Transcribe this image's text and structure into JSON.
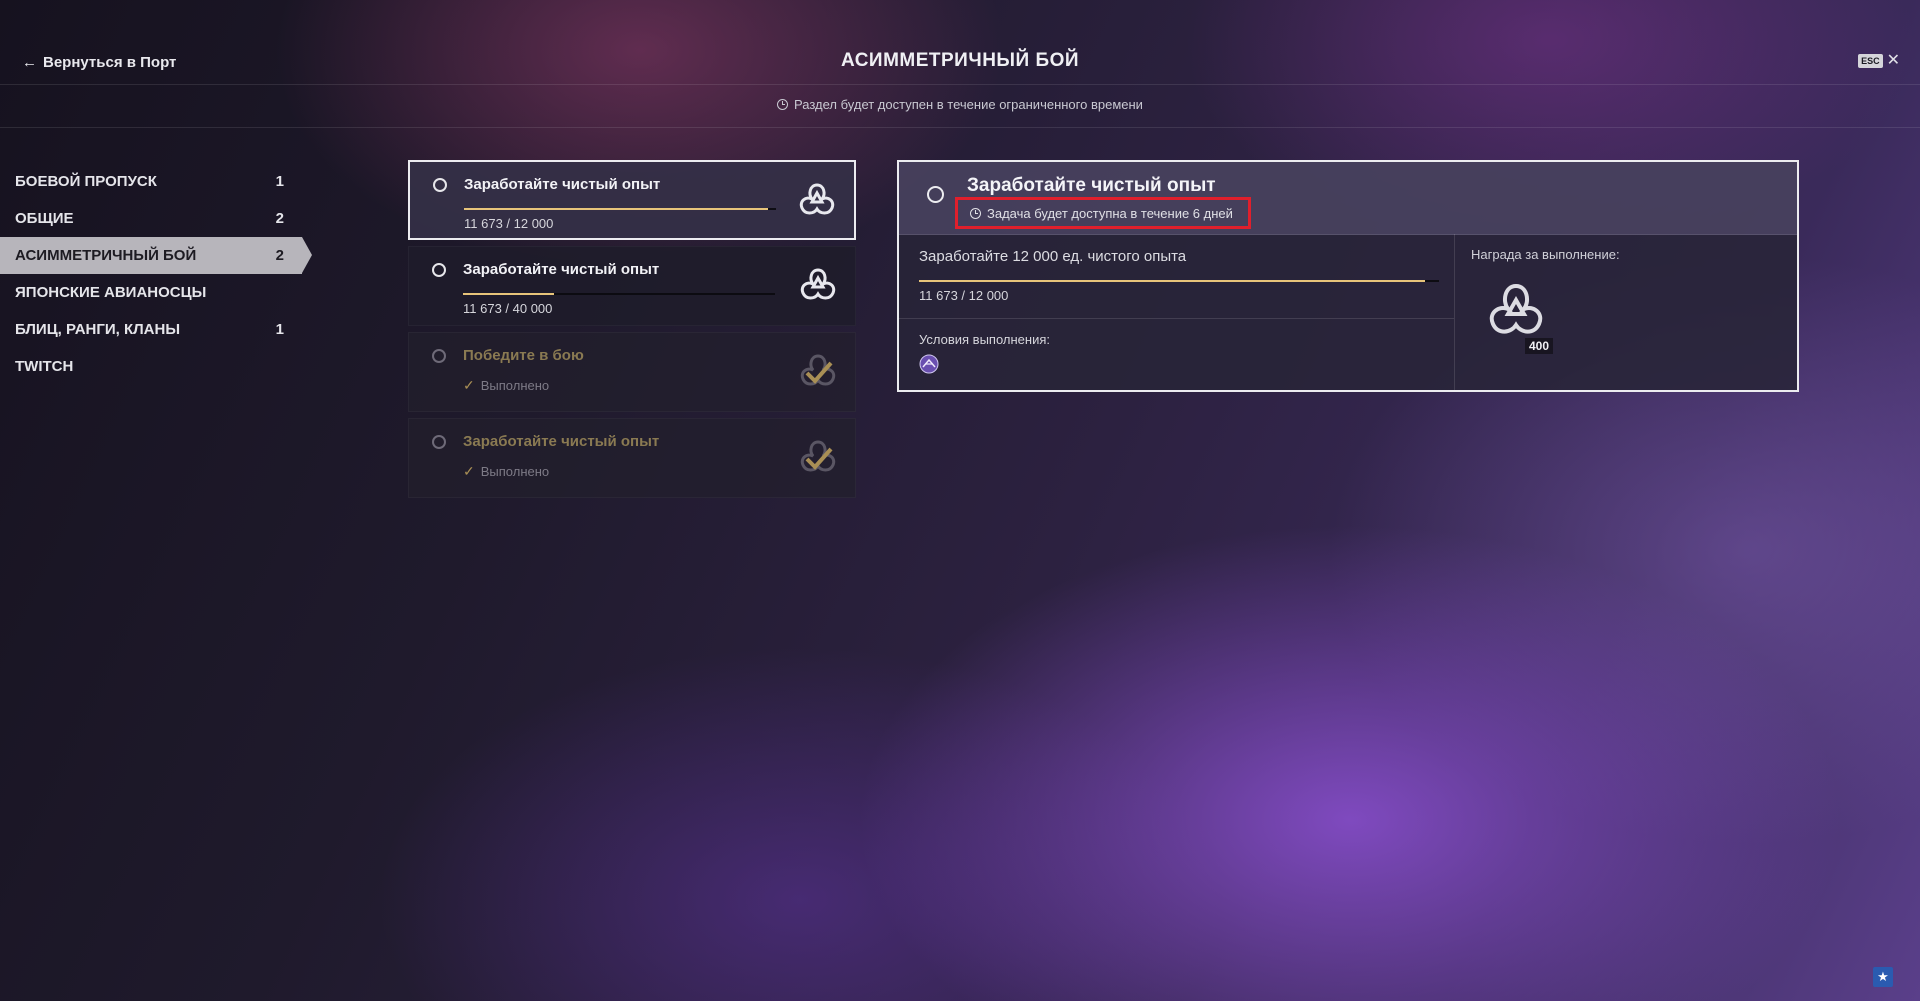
{
  "header": {
    "back_label": "Вернуться в Порт",
    "title": "АСИММЕТРИЧНЫЙ БОЙ",
    "esc_label": "ESC",
    "close_glyph": "✕",
    "subtitle": "Раздел будет доступен в течение ограниченного времени"
  },
  "sidebar": {
    "items": [
      {
        "label": "БОЕВОЙ ПРОПУСК",
        "count": "1"
      },
      {
        "label": "ОБЩИЕ",
        "count": "2"
      },
      {
        "label": "АСИММЕТРИЧНЫЙ БОЙ",
        "count": "2",
        "active": true
      },
      {
        "label": "ЯПОНСКИЕ АВИАНОСЦЫ",
        "count": ""
      },
      {
        "label": "БЛИЦ, РАНГИ, КЛАНЫ",
        "count": "1"
      },
      {
        "label": "TWITCH",
        "count": ""
      }
    ]
  },
  "tasks": [
    {
      "title": "Заработайте чистый опыт",
      "progress": "11 673 / 12 000",
      "fraction": 0.973,
      "state": "selected",
      "icon": "free-xp-icon"
    },
    {
      "title": "Заработайте чистый опыт",
      "progress": "11 673 / 40 000",
      "fraction": 0.292,
      "state": "active",
      "icon": "free-xp-icon"
    },
    {
      "title": "Победите в бою",
      "status": "Выполнено",
      "state": "done",
      "icon": "completed-check-icon"
    },
    {
      "title": "Заработайте чистый опыт",
      "status": "Выполнено",
      "state": "done",
      "icon": "completed-check-icon"
    }
  ],
  "detail": {
    "title": "Заработайте чистый опыт",
    "timer_note": "Задача будет доступна в течение 6 дней",
    "goal_text": "Заработайте 12 000 ед. чистого опыта",
    "progress": "11 673 / 12 000",
    "fraction": 0.973,
    "conditions_label": "Условия выполнения:",
    "reward_label": "Награда за выполнение:",
    "reward_count": "400"
  },
  "colors": {
    "progress_fill": "#e7c47a",
    "highlight_box": "#e01f2c",
    "done_text": "#8a7a52"
  }
}
